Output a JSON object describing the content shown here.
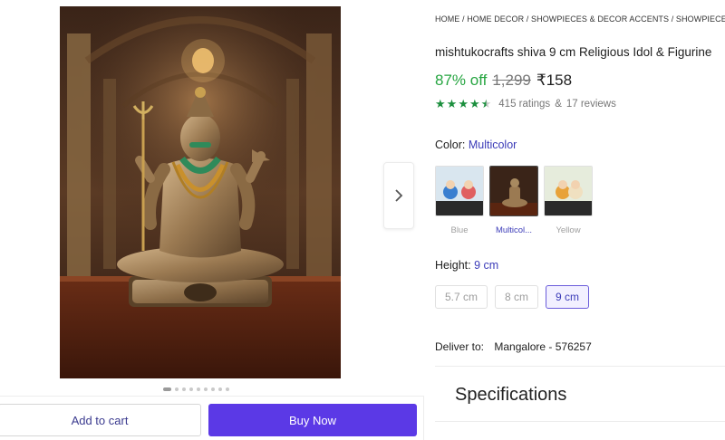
{
  "gallery": {
    "image_alt": "Shiva idol",
    "dot_count": 9,
    "active_dot": 0
  },
  "actions": {
    "add_to_cart": "Add to cart",
    "buy_now": "Buy Now"
  },
  "breadcrumb": "HOME / HOME DECOR / SHOWPIECES & DECOR ACCENTS / SHOWPIECES & FIG",
  "product": {
    "title": "mishtukocrafts shiva 9 cm Religious Idol & Figurine",
    "discount": "87% off",
    "mrp": "1,299",
    "price": "₹158",
    "rating_value": 4.5,
    "ratings": "415 ratings",
    "amp": "&",
    "reviews": "17 reviews"
  },
  "color": {
    "label": "Color:",
    "selected": "Multicolor",
    "options": [
      {
        "caption": "Blue"
      },
      {
        "caption": "Multicol..."
      },
      {
        "caption": "Yellow"
      }
    ]
  },
  "height": {
    "label": "Height:",
    "selected": "9 cm",
    "options": [
      "5.7 cm",
      "8 cm",
      "9 cm"
    ]
  },
  "delivery": {
    "label": "Deliver to:",
    "location": "Mangalore - 576257"
  },
  "specifications": {
    "title": "Specifications"
  },
  "colors": {
    "discount_green": "#26a541",
    "star_green": "#1c8f3e",
    "buy_button": "#5b39e6",
    "link_blue": "#3b3bb8"
  }
}
